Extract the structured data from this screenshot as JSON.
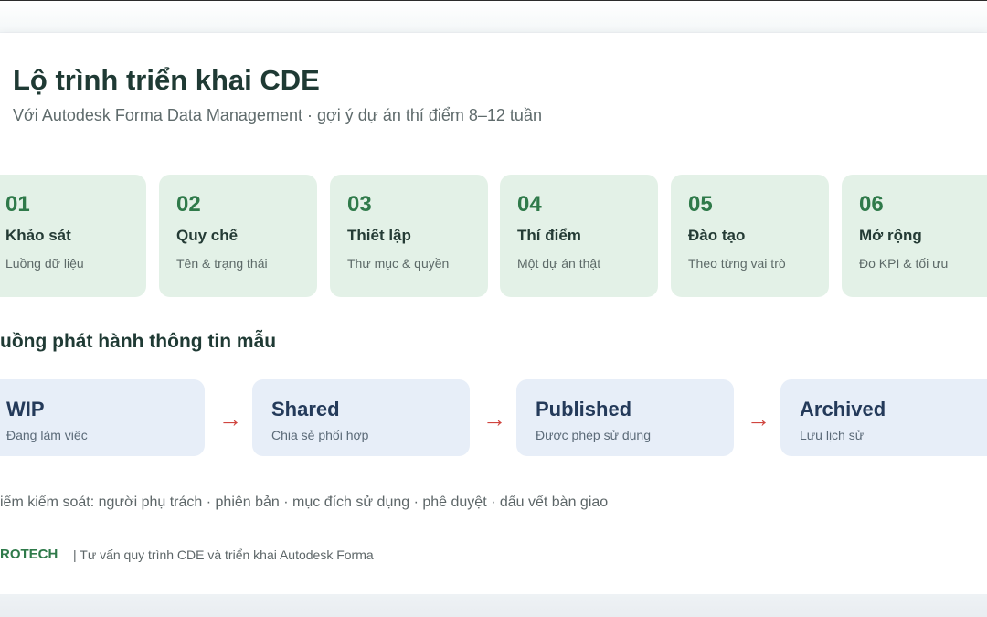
{
  "header": {
    "title": "Lộ trình triển khai CDE",
    "subtitle": "Với Autodesk Forma Data Management · gợi ý dự án thí điểm 8–12 tuần"
  },
  "steps": [
    {
      "num": "01",
      "name": "Khảo sát",
      "desc": "Luồng dữ liệu"
    },
    {
      "num": "02",
      "name": "Quy chế",
      "desc": "Tên & trạng thái"
    },
    {
      "num": "03",
      "name": "Thiết lập",
      "desc": "Thư mục & quyền"
    },
    {
      "num": "04",
      "name": "Thí điểm",
      "desc": "Một dự án thật"
    },
    {
      "num": "05",
      "name": "Đào tạo",
      "desc": "Theo từng vai trò"
    },
    {
      "num": "06",
      "name": "Mở rộng",
      "desc": "Đo KPI & tối ưu"
    }
  ],
  "flow": {
    "title": "uồng phát hành thông tin mẫu",
    "states": [
      {
        "name": "WIP",
        "desc": "Đang làm việc"
      },
      {
        "name": "Shared",
        "desc": "Chia sẻ phối hợp"
      },
      {
        "name": "Published",
        "desc": "Được phép sử dụng"
      },
      {
        "name": "Archived",
        "desc": "Lưu lịch sử"
      }
    ],
    "arrow": "→"
  },
  "controls_text": "iểm kiểm soát: người phụ trách · phiên bản · mục đích sử dụng · phê duyệt · dấu vết bàn giao",
  "footer": {
    "brand": "ROTECH",
    "tagline": "| Tư vấn quy trình CDE và triển khai Autodesk Forma"
  },
  "colors": {
    "step_bg": "#e3f1e7",
    "step_num": "#2f7a4a",
    "flow_bg": "#e7eef8",
    "arrow": "#d0453f",
    "brand": "#2f7a4a"
  }
}
